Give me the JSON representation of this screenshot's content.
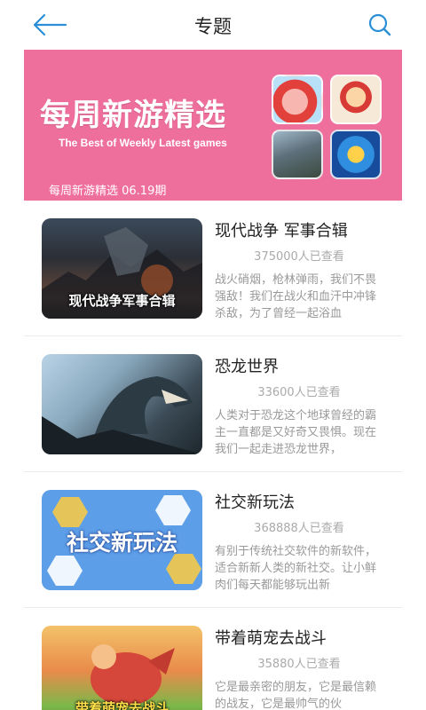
{
  "header": {
    "title": "专题"
  },
  "banner": {
    "title": "每周新游精选",
    "subtitle": "The Best of Weekly Latest games",
    "date_label": "每周新游精选 06.19期"
  },
  "topics": [
    {
      "title": "现代战争 军事合辑",
      "views": "375000人已查看",
      "description": "战火硝烟，枪林弹雨，我们不畏强敌！我们在战火和血汗中冲锋杀敌，为了曾经一起浴血",
      "thumb_caption": "现代战争军事合辑"
    },
    {
      "title": "恐龙世界",
      "views": "33600人已查看",
      "description": "人类对于恐龙这个地球曾经的霸主一直都是又好奇又畏惧。现在我们一起走进恐龙世界，",
      "thumb_caption": ""
    },
    {
      "title": "社交新玩法",
      "views": "368888人已查看",
      "description": "有别于传统社交软件的新软件，适合新新人类的新社交。让小鲜肉们每天都能够玩出新",
      "thumb_caption": "社交新玩法"
    },
    {
      "title": "带着萌宠去战斗",
      "views": "35880人已查看",
      "description": "它是最亲密的朋友，它是最信赖的战友，它是最帅气的伙",
      "thumb_caption": "带着萌宠去战斗"
    }
  ],
  "colors": {
    "accent": "#2a8fd6",
    "banner_bg": "#ef6f9c"
  },
  "icons": {
    "back": "back-arrow-icon",
    "search": "search-icon"
  }
}
